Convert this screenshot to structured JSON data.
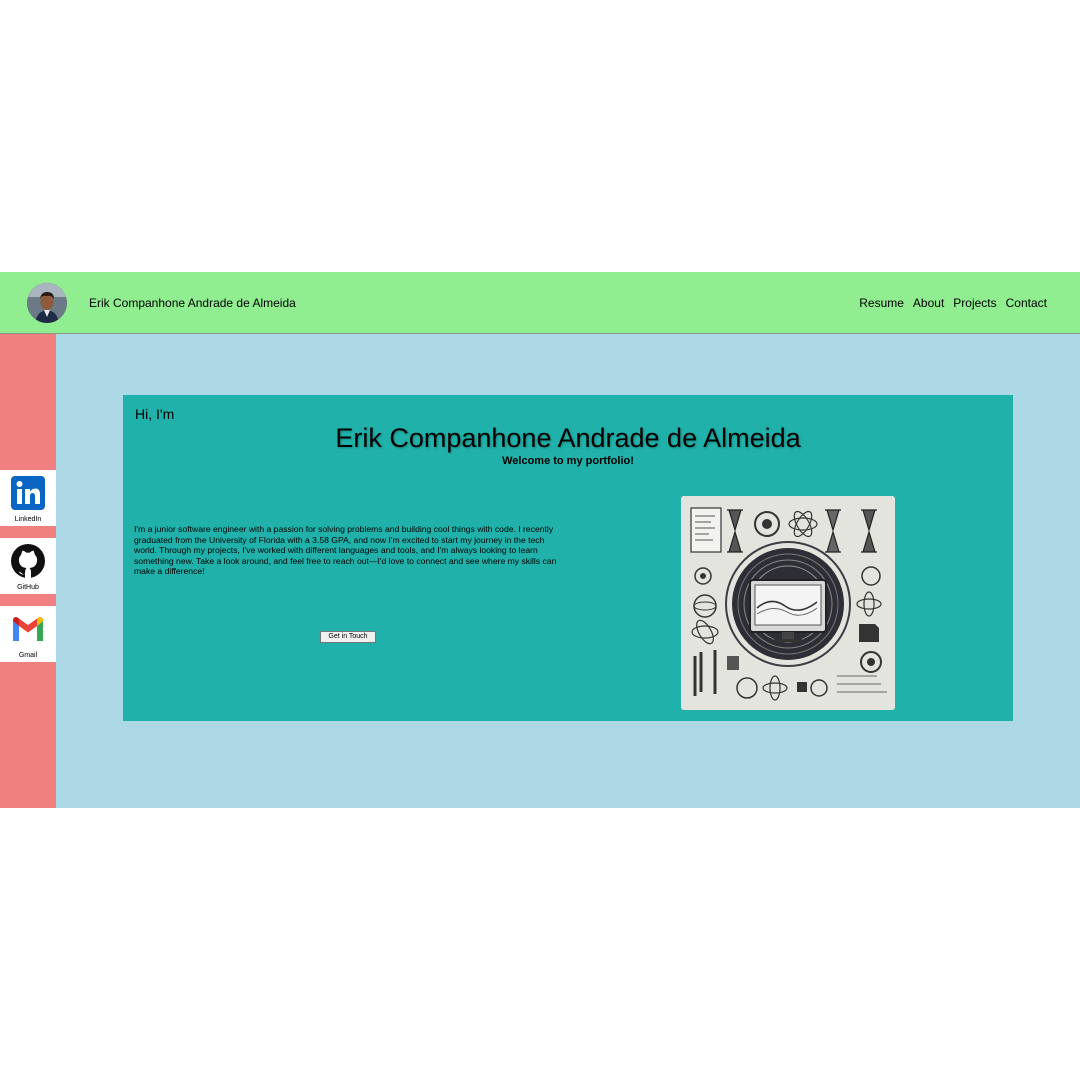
{
  "header": {
    "site_name": "Erik Companhone Andrade de Almeida",
    "nav": [
      "Resume",
      "About",
      "Projects",
      "Contact"
    ]
  },
  "socials": [
    {
      "label": "LinkedIn",
      "icon": "linkedin-icon"
    },
    {
      "label": "GitHub",
      "icon": "github-icon"
    },
    {
      "label": "Gmail",
      "icon": "gmail-icon"
    }
  ],
  "hero": {
    "greeting": "Hi, I'm",
    "name": "Erik Companhone Andrade de Almeida",
    "tagline": "Welcome to my portfolio!",
    "bio": "I'm a junior software engineer with a passion for solving problems and building cool things with code. I recently graduated from the University of Florida with a 3.58 GPA, and now I'm excited to start my journey in the tech world. Through my projects, I've worked with different languages and tools, and I'm always looking to learn something new. Take a look around, and feel free to reach out—I'd love to connect and see where my skills can make a difference!",
    "cta_label": "Get in Touch"
  },
  "colors": {
    "header_bg": "#90ee90",
    "sidebar_bg": "#f08080",
    "main_bg": "#add8e6",
    "hero_bg": "#20b2aa",
    "linkedin_blue": "#0a66c2"
  }
}
